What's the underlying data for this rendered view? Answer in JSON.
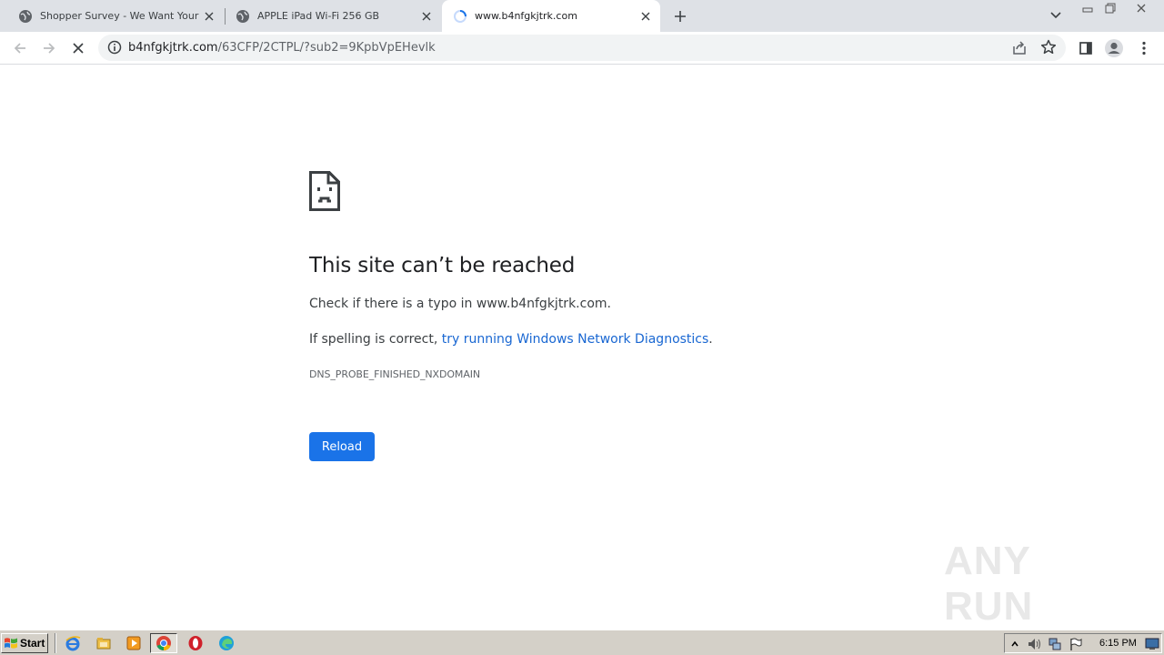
{
  "browser": {
    "tabs": [
      {
        "title": "Shopper Survey - We Want Your Opinion",
        "active": false,
        "favicon": "globe-icon"
      },
      {
        "title": "APPLE iPad Wi-Fi 256 GB",
        "active": false,
        "favicon": "globe-icon"
      },
      {
        "title": "www.b4nfgkjtrk.com",
        "active": true,
        "favicon": "loading-spinner-icon"
      }
    ],
    "address_bar": {
      "host": "b4nfgkjtrk.com",
      "path": "/63CFP/2CTPL/?sub2=9KpbVpEHevlk"
    }
  },
  "error_page": {
    "title": "This site can’t be reached",
    "line1": "Check if there is a typo in www.b4nfgkjtrk.com.",
    "line2_prefix": "If spelling is correct, ",
    "line2_link": "try running Windows Network Diagnostics",
    "line2_suffix": ".",
    "error_code": "DNS_PROBE_FINISHED_NXDOMAIN",
    "reload_label": "Reload"
  },
  "watermark": {
    "text": "ANY RUN"
  },
  "taskbar": {
    "start_label": "Start",
    "apps": [
      "ie-icon",
      "explorer-icon",
      "media-player-icon",
      "chrome-icon",
      "opera-icon",
      "edge-icon"
    ],
    "clock": "6:15 PM"
  },
  "colors": {
    "accent": "#1a73e8",
    "link": "#1967d2",
    "tabstrip": "#dee1e6",
    "omnibox": "#f1f3f4",
    "taskbar": "#d4d0c8"
  }
}
